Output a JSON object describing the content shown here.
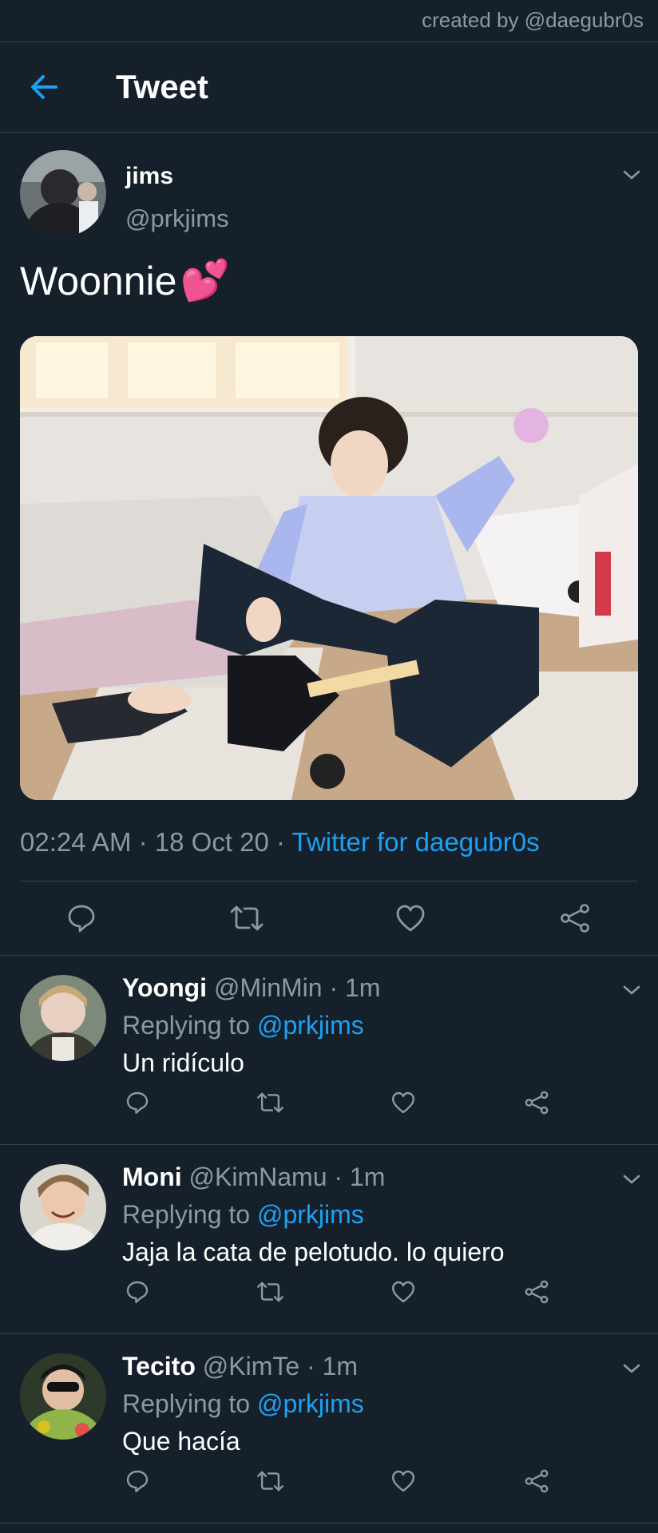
{
  "watermark": "created by @daegubr0s",
  "header": {
    "title": "Tweet",
    "back_icon": "arrow-left-icon"
  },
  "tweet": {
    "author_name": "jims",
    "author_handle": "@prkjims",
    "text": "Woonnie",
    "emoji": "💕",
    "time": "02:24 AM",
    "separator": "·",
    "date": "18 Oct 20",
    "source": "Twitter for daegubr0s",
    "actions": [
      "reply-icon",
      "retweet-icon",
      "like-icon",
      "share-icon"
    ]
  },
  "replying_label": "Replying to",
  "replies": [
    {
      "name": "Yoongi",
      "handle": "@MinMin",
      "dot": "·",
      "time": "1m",
      "mention": "@prkjims",
      "text": "Un ridículo"
    },
    {
      "name": "Moni",
      "handle": "@KimNamu",
      "dot": "·",
      "time": "1m",
      "mention": "@prkjims",
      "text": "Jaja la cata de pelotudo. lo quiero"
    },
    {
      "name": "Tecito",
      "handle": "@KimTe",
      "dot": "·",
      "time": "1m",
      "mention": "@prkjims",
      "text": "Que hacía"
    }
  ],
  "colors": {
    "background": "#15202b",
    "accent": "#1da1f2",
    "muted": "#8b98a5",
    "divider": "#38444d"
  }
}
